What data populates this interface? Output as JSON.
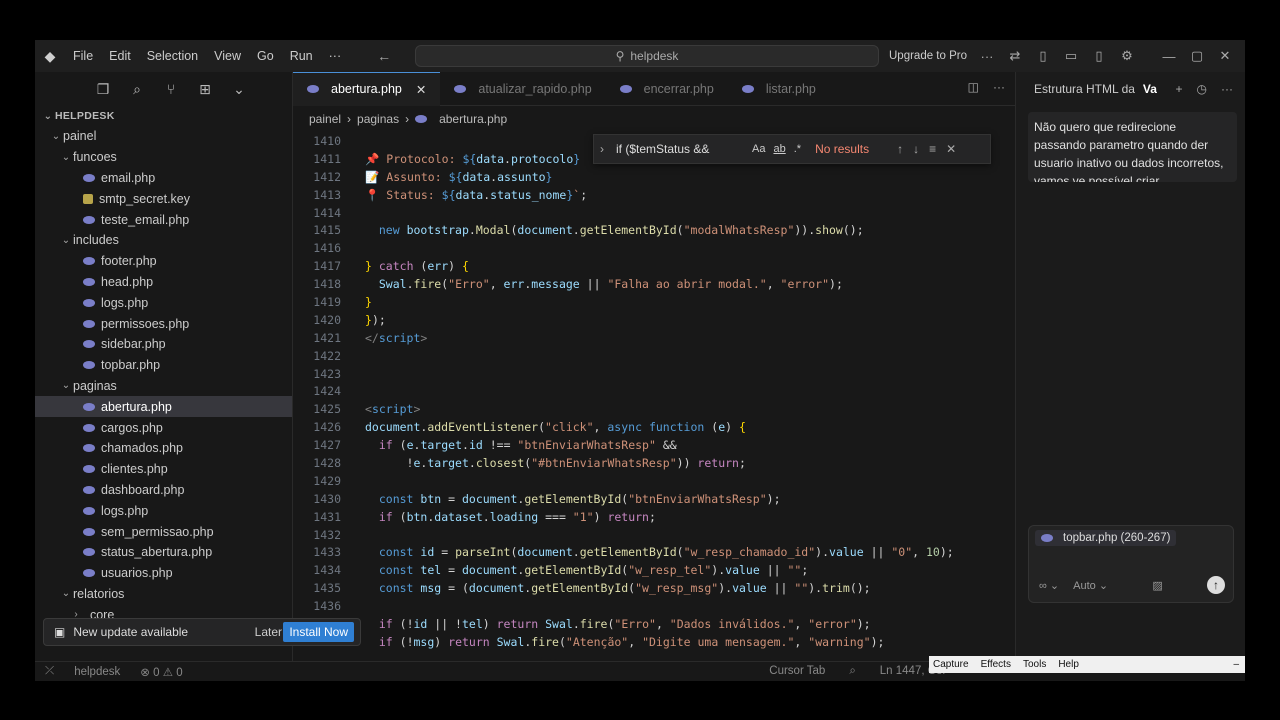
{
  "titlebar": {
    "menus": [
      "File",
      "Edit",
      "Selection",
      "View",
      "Go",
      "Run",
      "···"
    ],
    "search_text": "helpdesk",
    "upgrade_label": "Upgrade to Pro"
  },
  "sidebar": {
    "section": "HELPDESK",
    "rows": [
      {
        "label": "painel",
        "type": "folder",
        "indent": 1,
        "open": true
      },
      {
        "label": "funcoes",
        "type": "folder",
        "indent": 2,
        "open": true
      },
      {
        "label": "email.php",
        "type": "php",
        "indent": 3
      },
      {
        "label": "smtp_secret.key",
        "type": "key",
        "indent": 3
      },
      {
        "label": "teste_email.php",
        "type": "php",
        "indent": 3
      },
      {
        "label": "includes",
        "type": "folder",
        "indent": 2,
        "open": true
      },
      {
        "label": "footer.php",
        "type": "php",
        "indent": 3
      },
      {
        "label": "head.php",
        "type": "php",
        "indent": 3
      },
      {
        "label": "logs.php",
        "type": "php",
        "indent": 3
      },
      {
        "label": "permissoes.php",
        "type": "php",
        "indent": 3
      },
      {
        "label": "sidebar.php",
        "type": "php",
        "indent": 3
      },
      {
        "label": "topbar.php",
        "type": "php",
        "indent": 3
      },
      {
        "label": "paginas",
        "type": "folder",
        "indent": 2,
        "open": true
      },
      {
        "label": "abertura.php",
        "type": "php",
        "indent": 3,
        "selected": true
      },
      {
        "label": "cargos.php",
        "type": "php",
        "indent": 3
      },
      {
        "label": "chamados.php",
        "type": "php",
        "indent": 3
      },
      {
        "label": "clientes.php",
        "type": "php",
        "indent": 3
      },
      {
        "label": "dashboard.php",
        "type": "php",
        "indent": 3
      },
      {
        "label": "logs.php",
        "type": "php",
        "indent": 3
      },
      {
        "label": "sem_permissao.php",
        "type": "php",
        "indent": 3
      },
      {
        "label": "status_abertura.php",
        "type": "php",
        "indent": 3
      },
      {
        "label": "usuarios.php",
        "type": "php",
        "indent": 3
      },
      {
        "label": "relatorios",
        "type": "folder",
        "indent": 2,
        "open": true
      },
      {
        "label": "_core",
        "type": "folder",
        "indent": 3,
        "open": false
      }
    ],
    "update_toast": {
      "text": "New update available",
      "later": "Later",
      "install": "Install Now"
    }
  },
  "editor": {
    "tabs": [
      {
        "label": "abertura.php",
        "active": true
      },
      {
        "label": "atualizar_rapido.php",
        "active": false
      },
      {
        "label": "encerrar.php",
        "active": false
      },
      {
        "label": "listar.php",
        "active": false
      }
    ],
    "breadcrumb": [
      "painel",
      "paginas",
      "abertura.php"
    ],
    "find": {
      "query": "if ($temStatus &&",
      "result": "No results",
      "opt_case": "Aa",
      "opt_word": "ab",
      "opt_regex": ".*"
    },
    "lines": [
      {
        "n": "1410",
        "html": ""
      },
      {
        "n": "1411",
        "html": "<span class='emoji'>📌</span> <span class='str'>Protocolo: </span><span class='kw'>${</span><span class='var'>data</span>.<span class='var'>protocolo</span><span class='kw'>}</span>"
      },
      {
        "n": "1412",
        "html": "<span class='emoji'>📝</span> <span class='str'>Assunto: </span><span class='kw'>${</span><span class='var'>data</span>.<span class='var'>assunto</span><span class='kw'>}</span>"
      },
      {
        "n": "1413",
        "html": "<span class='emoji'>📍</span> <span class='str'>Status: </span><span class='kw'>${</span><span class='var'>data</span>.<span class='var'>status_nome</span><span class='kw'>}</span><span class='str'>`</span>;"
      },
      {
        "n": "1414",
        "html": ""
      },
      {
        "n": "1415",
        "html": "  <span class='kw'>new</span> <span class='var'>bootstrap</span>.<span class='fn'>Modal</span>(<span class='var'>document</span>.<span class='fn'>getElementById</span>(<span class='str'>\"modalWhatsResp\"</span>)).<span class='fn'>show</span>();"
      },
      {
        "n": "1416",
        "html": ""
      },
      {
        "n": "1417",
        "html": "<span class='pn'>}</span> <span class='ctl'>catch</span> (<span class='var'>err</span>) <span class='pn'>{</span>"
      },
      {
        "n": "1418",
        "html": "  <span class='var'>Swal</span>.<span class='fn'>fire</span>(<span class='str'>\"Erro\"</span>, <span class='var'>err</span>.<span class='var'>message</span> || <span class='str'>\"Falha ao abrir modal.\"</span>, <span class='str'>\"error\"</span>);"
      },
      {
        "n": "1419",
        "html": "<span class='pn'>}</span>"
      },
      {
        "n": "1420",
        "html": "<span class='pn'>}</span>);"
      },
      {
        "n": "1421",
        "html": "<span class='tag'>&lt;/</span><span class='kw'>script</span><span class='tag'>&gt;</span>"
      },
      {
        "n": "1422",
        "html": ""
      },
      {
        "n": "1423",
        "html": ""
      },
      {
        "n": "1424",
        "html": ""
      },
      {
        "n": "1425",
        "html": "<span class='tag'>&lt;</span><span class='kw'>script</span><span class='tag'>&gt;</span>"
      },
      {
        "n": "1426",
        "html": "<span class='var'>document</span>.<span class='fn'>addEventListener</span>(<span class='str'>\"click\"</span>, <span class='kw'>async</span> <span class='kw'>function</span> (<span class='var'>e</span>) <span class='pn'>{</span>"
      },
      {
        "n": "1427",
        "html": "  <span class='ctl'>if</span> (<span class='var'>e</span>.<span class='var'>target</span>.<span class='var'>id</span> !== <span class='str'>\"btnEnviarWhatsResp\"</span> &amp;&amp;"
      },
      {
        "n": "1428",
        "html": "      !<span class='var'>e</span>.<span class='var'>target</span>.<span class='fn'>closest</span>(<span class='str'>\"#btnEnviarWhatsResp\"</span>)) <span class='ctl'>return</span>;"
      },
      {
        "n": "1429",
        "html": ""
      },
      {
        "n": "1430",
        "html": "  <span class='kw'>const</span> <span class='var'>btn</span> = <span class='var'>document</span>.<span class='fn'>getElementById</span>(<span class='str'>\"btnEnviarWhatsResp\"</span>);"
      },
      {
        "n": "1431",
        "html": "  <span class='ctl'>if</span> (<span class='var'>btn</span>.<span class='var'>dataset</span>.<span class='var'>loading</span> === <span class='str'>\"1\"</span>) <span class='ctl'>return</span>;"
      },
      {
        "n": "1432",
        "html": ""
      },
      {
        "n": "1433",
        "html": "  <span class='kw'>const</span> <span class='var'>id</span> = <span class='fn'>parseInt</span>(<span class='var'>document</span>.<span class='fn'>getElementById</span>(<span class='str'>\"w_resp_chamado_id\"</span>).<span class='var'>value</span> || <span class='str'>\"0\"</span>, <span class='num'>10</span>);"
      },
      {
        "n": "1434",
        "html": "  <span class='kw'>const</span> <span class='var'>tel</span> = <span class='var'>document</span>.<span class='fn'>getElementById</span>(<span class='str'>\"w_resp_tel\"</span>).<span class='var'>value</span> || <span class='str'>\"\"</span>;"
      },
      {
        "n": "1435",
        "html": "  <span class='kw'>const</span> <span class='var'>msg</span> = (<span class='var'>document</span>.<span class='fn'>getElementById</span>(<span class='str'>\"w_resp_msg\"</span>).<span class='var'>value</span> || <span class='str'>\"\"</span>).<span class='fn'>trim</span>();"
      },
      {
        "n": "1436",
        "html": ""
      },
      {
        "n": "1437",
        "html": "  <span class='ctl'>if</span> (!<span class='var'>id</span> || !<span class='var'>tel</span>) <span class='ctl'>return</span> <span class='var'>Swal</span>.<span class='fn'>fire</span>(<span class='str'>\"Erro\"</span>, <span class='str'>\"Dados inválidos.\"</span>, <span class='str'>\"error\"</span>);"
      },
      {
        "n": "1438",
        "html": "  <span class='ctl'>if</span> (!<span class='var'>msg</span>) <span class='ctl'>return</span> <span class='var'>Swal</span>.<span class='fn'>fire</span>(<span class='str'>\"Atenção\"</span>, <span class='str'>\"Digite uma mensagem.\"</span>, <span class='str'>\"warning\"</span>);"
      }
    ]
  },
  "chat": {
    "tab_label": "Estrutura HTML da",
    "tab_second": "Va",
    "message": "Não quero que redirecione passando parametro quando der usuario inativo ou dados incorretos, vamos ve possível criar",
    "context_chip": "topbar.php (260-267)",
    "mode": "Auto"
  },
  "statusbar": {
    "branch": "helpdesk",
    "errors": "0",
    "warnings": "0",
    "cursor_tab": "Cursor Tab",
    "position": "Ln 1447, Col"
  },
  "capture_bar": {
    "items": [
      "Capture",
      "Effects",
      "Tools",
      "Help"
    ]
  }
}
